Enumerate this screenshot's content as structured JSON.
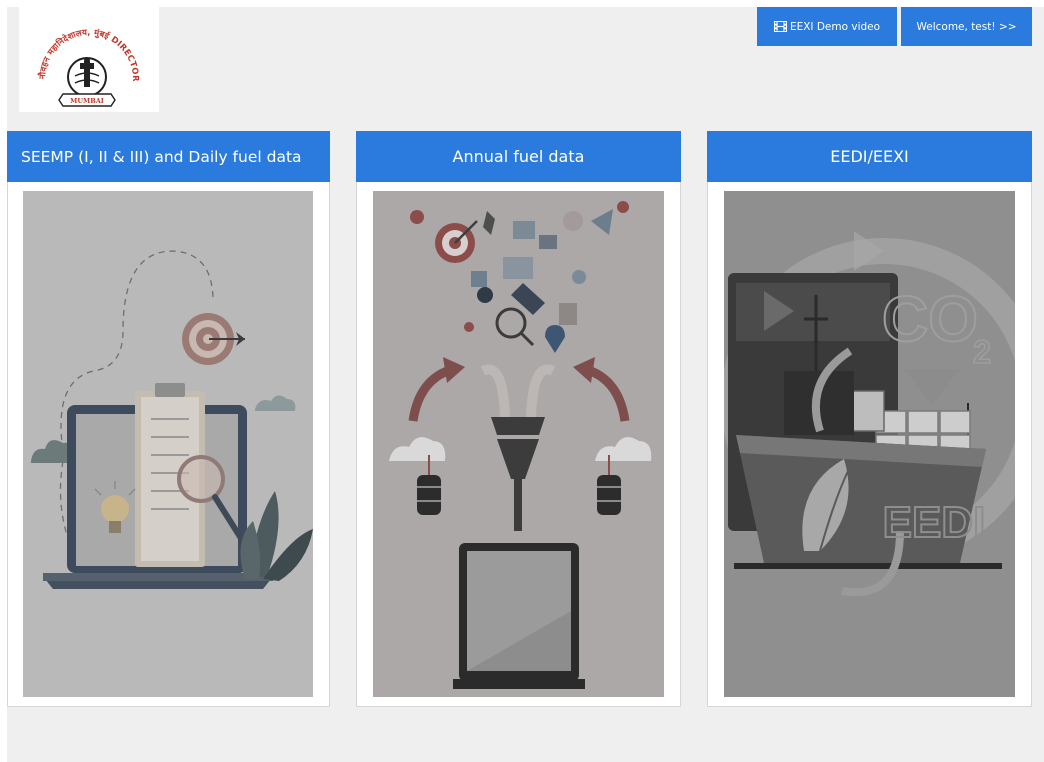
{
  "header": {
    "logo": {
      "arc_text": "नौवहन महानिदेशालय, मुंबई DIRECTORATE GENERAL OF SHIPPING",
      "ribbon_text": "MUMBAI",
      "icon": "lighthouse-emblem-icon"
    },
    "demo_button": {
      "label": "EEXI Demo video",
      "icon": "film-icon"
    },
    "welcome_button": {
      "label": "Welcome, test! >>"
    }
  },
  "cards": [
    {
      "title": "SEEMP (I, II & III) and Daily fuel data",
      "image_icon": "laptop-checklist-target-icon"
    },
    {
      "title": "Annual fuel data",
      "image_icon": "data-funnel-laptop-icon"
    },
    {
      "title": "EEDI/EEXI",
      "image_icon": "ship-co2-eedi-icon",
      "image_labels": {
        "co2": "CO",
        "co2_sub": "2",
        "eedi": "EEDI"
      }
    }
  ],
  "colors": {
    "accent": "#2a7bdd",
    "page_background": "#efefef",
    "card_background": "#ffffff"
  }
}
